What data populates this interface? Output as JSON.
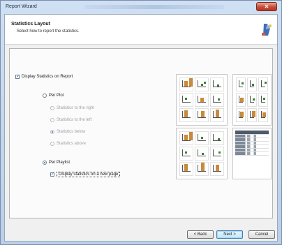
{
  "window": {
    "title": "Report Wizard",
    "close_glyph": "✕"
  },
  "header": {
    "title": "Statistics Layout",
    "subtitle": "Select how to report the statistics.",
    "icon": "wizard-icon"
  },
  "options": {
    "display_statistics": {
      "label": "Display Statistics on Report",
      "checked": true
    },
    "per_plot": {
      "label": "Per Plot",
      "selected": false
    },
    "per_plot_choices": [
      {
        "label": "Statistics to the right",
        "selected": false
      },
      {
        "label": "Statistics to the left",
        "selected": false
      },
      {
        "label": "Statistics below",
        "selected": true
      },
      {
        "label": "Statistics above",
        "selected": false
      }
    ],
    "per_playlist": {
      "label": "Per Playlist",
      "selected": true
    },
    "new_page": {
      "label": "Display statistics on a new page",
      "checked": true
    }
  },
  "footer": {
    "back": "< Back",
    "next": "Next >",
    "cancel": "Cancel"
  }
}
